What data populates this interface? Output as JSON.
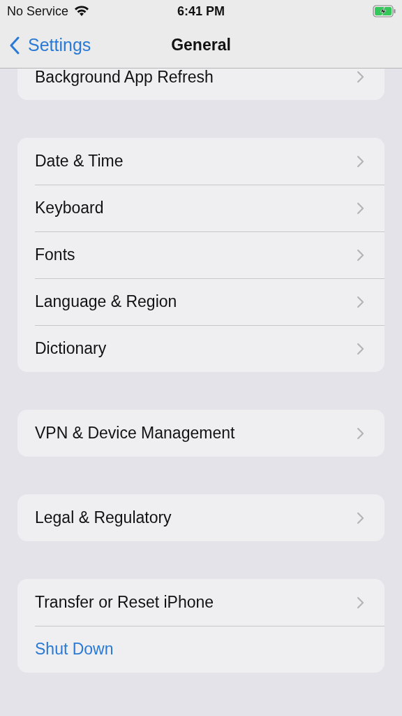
{
  "status_bar": {
    "carrier": "No Service",
    "time": "6:41 PM"
  },
  "nav": {
    "back": "Settings",
    "title": "General"
  },
  "groups": [
    {
      "rows": [
        {
          "label": "Background App Refresh",
          "kind": "link"
        }
      ]
    },
    {
      "rows": [
        {
          "label": "Date & Time",
          "kind": "link"
        },
        {
          "label": "Keyboard",
          "kind": "link"
        },
        {
          "label": "Fonts",
          "kind": "link"
        },
        {
          "label": "Language & Region",
          "kind": "link"
        },
        {
          "label": "Dictionary",
          "kind": "link"
        }
      ]
    },
    {
      "rows": [
        {
          "label": "VPN & Device Management",
          "kind": "link"
        }
      ]
    },
    {
      "rows": [
        {
          "label": "Legal & Regulatory",
          "kind": "link"
        }
      ]
    },
    {
      "rows": [
        {
          "label": "Transfer or Reset iPhone",
          "kind": "link"
        },
        {
          "label": "Shut Down",
          "kind": "action"
        }
      ]
    }
  ]
}
